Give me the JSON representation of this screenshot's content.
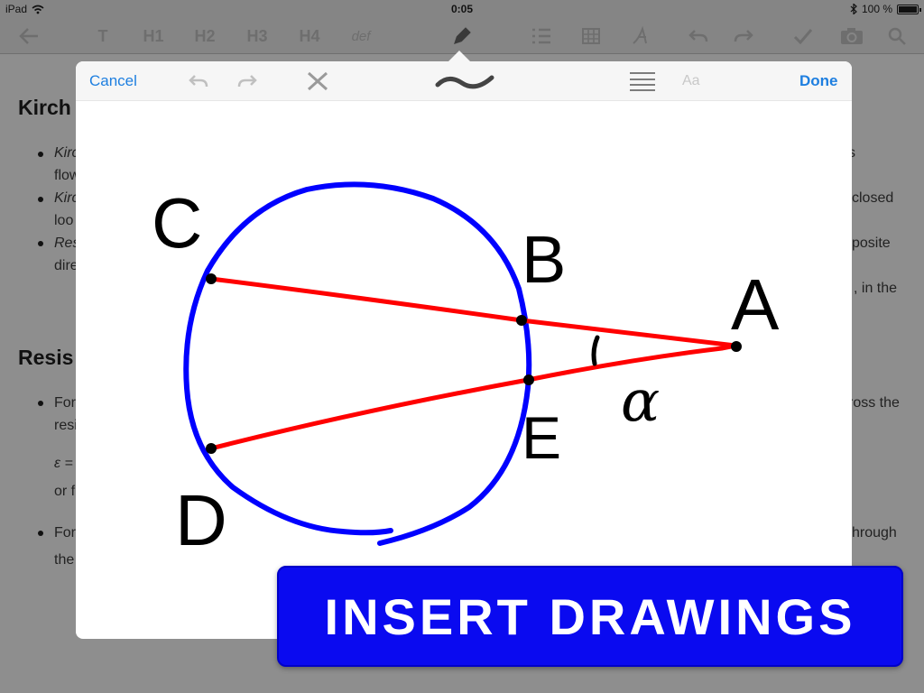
{
  "status_bar": {
    "device": "iPad",
    "time": "0:05",
    "battery": "100 %",
    "battery_level": 1.0
  },
  "toolbar": {
    "items": [
      {
        "label": "T"
      },
      {
        "label": "H1"
      },
      {
        "label": "H2"
      },
      {
        "label": "H3"
      },
      {
        "label": "H4"
      },
      {
        "label": "def"
      }
    ]
  },
  "document": {
    "heading1": "Kirch",
    "heading2": "Resis",
    "lines": [
      "Kirc",
      "s",
      "flow",
      "Kirc",
      "closed",
      "loo",
      "Res",
      "posite",
      "dire",
      ", in the",
      "For",
      "ross the",
      "resi",
      "ε =",
      "or f",
      "For",
      "hrough",
      "the"
    ]
  },
  "modal": {
    "cancel": "Cancel",
    "done": "Done",
    "font_button": "Aa"
  },
  "drawing": {
    "labels": {
      "c": "C",
      "b": "B",
      "a": "A",
      "e": "E",
      "d": "D",
      "alpha": "α"
    },
    "colors": {
      "circle": "#0000ff",
      "lines": "#ff0000",
      "ink": "#000000"
    }
  },
  "banner": {
    "text": "INSERT DRAWINGS",
    "color": "#0a0af0"
  }
}
